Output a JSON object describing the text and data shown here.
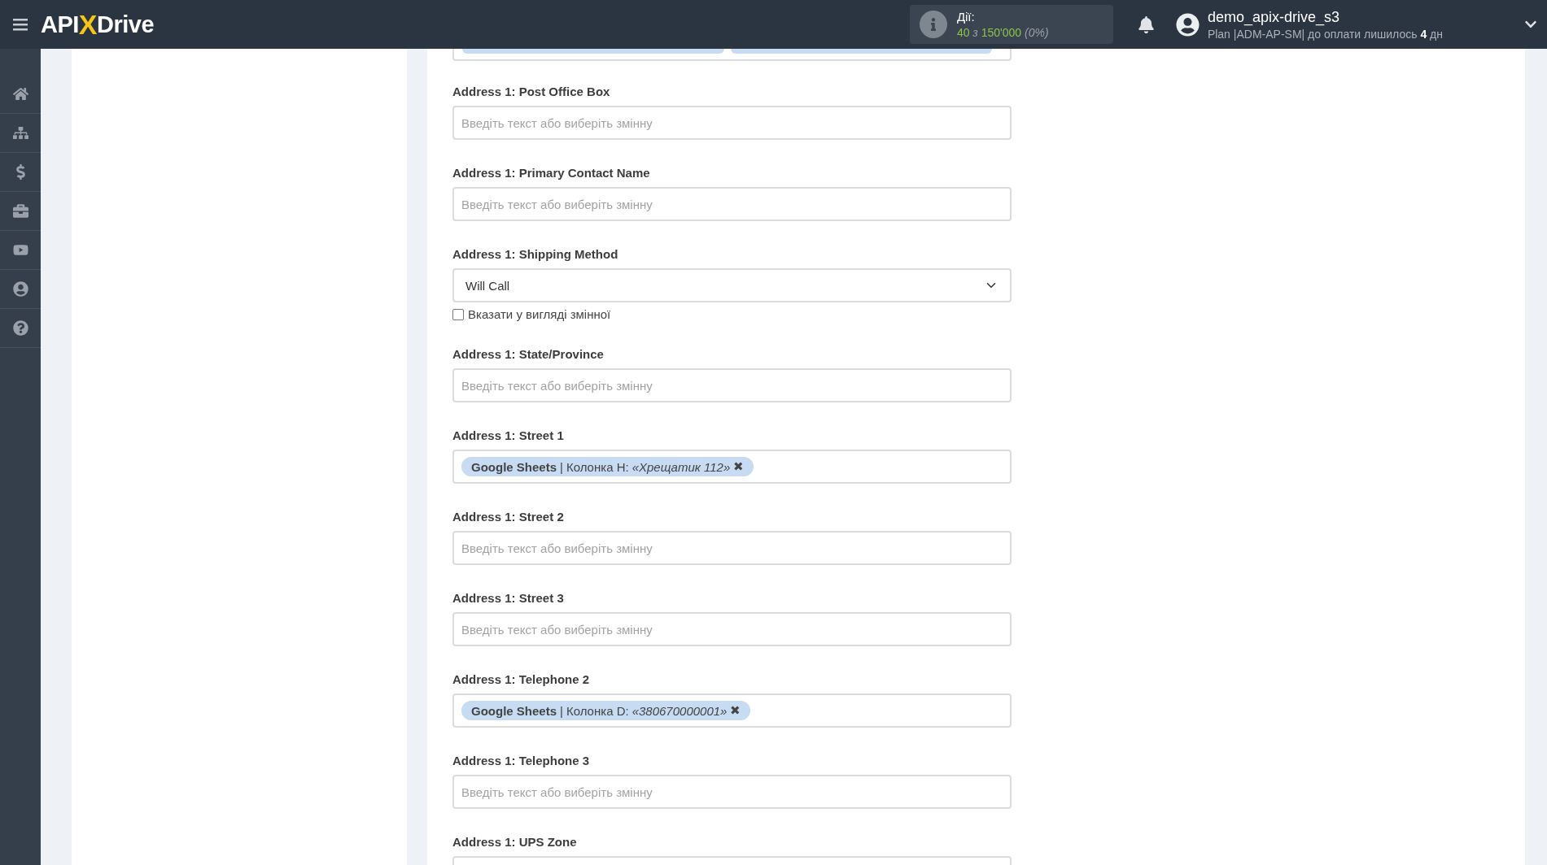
{
  "header": {
    "logo": {
      "left": "API",
      "mark": "X",
      "right": "Drive"
    },
    "actions": {
      "label": "Дії:",
      "used": "40",
      "of": "з",
      "total": "150'000",
      "percent": "(0%)"
    },
    "user": {
      "name": "demo_apix-drive_s3",
      "plan": "Plan",
      "code": "|ADM-AP-SM|",
      "due_text": "до оплати лишилось",
      "days": "4",
      "unit": "дн"
    }
  },
  "sidebar": {
    "items": [
      {
        "selected": false
      },
      {
        "selected": false
      },
      {
        "selected": false
      },
      {
        "selected": false
      },
      {
        "selected": false
      },
      {
        "selected": false
      },
      {
        "selected": false
      }
    ]
  },
  "fields": [
    {
      "kind": "cut"
    },
    {
      "kind": "text",
      "label": "Address 1: Post Office Box",
      "placeholder": "Введіть текст або виберіть змінну"
    },
    {
      "kind": "text",
      "label": "Address 1: Primary Contact Name",
      "placeholder": "Введіть текст або виберіть змінну"
    },
    {
      "kind": "select",
      "label": "Address 1: Shipping Method",
      "value": "Will Call",
      "checkbox": {
        "label": "Вказати у вигляді змінної",
        "checked": false
      }
    },
    {
      "kind": "text",
      "label": "Address 1: State/Province",
      "placeholder": "Введіть текст або виберіть змінну"
    },
    {
      "kind": "tags",
      "label": "Address 1: Street 1",
      "tags": [
        {
          "source": "Google Sheets",
          "separator": "|",
          "column": "Колонка H:",
          "value": "«Хрещатик 112»",
          "remove": "✖"
        }
      ]
    },
    {
      "kind": "text",
      "label": "Address 1: Street 2",
      "placeholder": "Введіть текст або виберіть змінну"
    },
    {
      "kind": "text",
      "label": "Address 1: Street 3",
      "placeholder": "Введіть текст або виберіть змінну"
    },
    {
      "kind": "tags",
      "label": "Address 1: Telephone 2",
      "tags": [
        {
          "source": "Google Sheets",
          "separator": "|",
          "column": "Колонка D:",
          "value": "«380670000001»",
          "remove": "✖"
        }
      ]
    },
    {
      "kind": "text",
      "label": "Address 1: Telephone 3",
      "placeholder": "Введіть текст або виберіть змінну"
    },
    {
      "kind": "text",
      "label": "Address 1: UPS Zone"
    }
  ]
}
